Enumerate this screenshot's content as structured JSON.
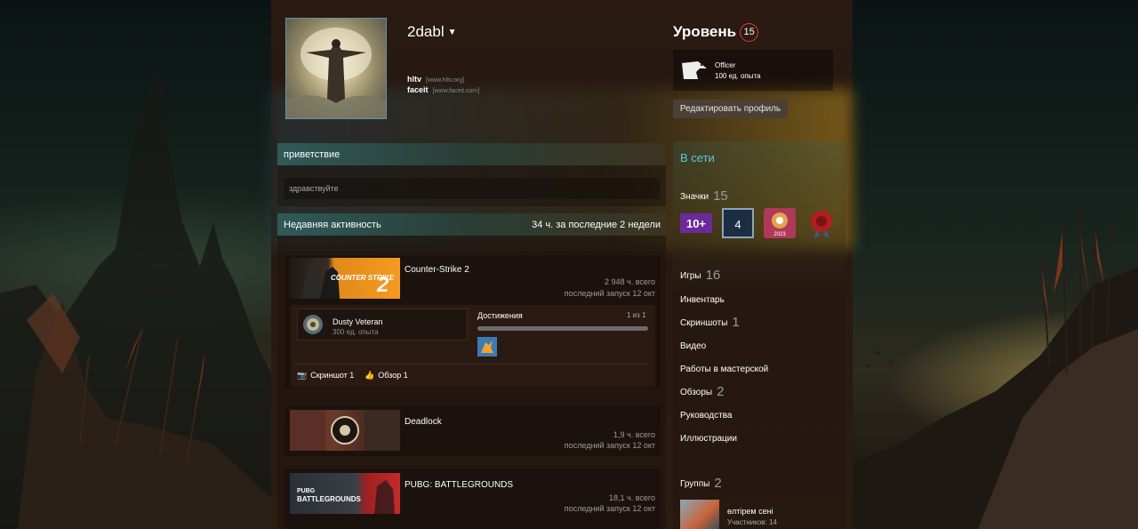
{
  "profile": {
    "name": "2dabl",
    "links": [
      {
        "label": "hltv",
        "url": "[www.hltv.org]"
      },
      {
        "label": "faceit",
        "url": "[www.faceit.com]"
      }
    ]
  },
  "level": {
    "label": "Уровень",
    "value": "15",
    "badge_title": "Officer",
    "badge_xp": "100 ед. опыта",
    "edit_button": "Редактировать профиль"
  },
  "greeting": {
    "title": "приветствие",
    "text": "здравствуйте"
  },
  "activity": {
    "title": "Недавняя активность",
    "summary": "34 ч. за последние 2 недели",
    "games": [
      {
        "name": "Counter-Strike 2",
        "hours": "2 948 ч. всего",
        "last": "последний запуск 12 окт"
      },
      {
        "name": "Deadlock",
        "hours": "1,9 ч. всего",
        "last": "последний запуск 12 окт"
      },
      {
        "name": "PUBG: BATTLEGROUNDS",
        "hours": "18,1 ч. всего",
        "last": "последний запуск 12 окт"
      }
    ],
    "achievement": {
      "badge_name": "Dusty Veteran",
      "badge_xp": "300 ед. опыта",
      "title": "Достижения",
      "count": "1 из 1",
      "progress": 1.0
    },
    "footer": {
      "screenshot": "Скриншот 1",
      "review": "Обзор 1"
    }
  },
  "sidebar": {
    "status": "В сети",
    "badges": {
      "label": "Значки",
      "count": "15",
      "icons": [
        "years-10-icon",
        "level-4-icon",
        "steam-2023-icon",
        "seal-award-icon"
      ],
      "years_text": "10+",
      "level_text": "4",
      "steam_year": "2023"
    },
    "items": [
      {
        "label": "Игры",
        "count": "16"
      },
      {
        "label": "Инвентарь",
        "count": ""
      },
      {
        "label": "Скриншоты",
        "count": "1"
      },
      {
        "label": "Видео",
        "count": ""
      },
      {
        "label": "Работы в мастерской",
        "count": ""
      },
      {
        "label": "Обзоры",
        "count": "2"
      },
      {
        "label": "Руководства",
        "count": ""
      },
      {
        "label": "Иллюстрации",
        "count": ""
      }
    ],
    "groups": {
      "label": "Группы",
      "count": "2",
      "first_name": "өлтірем сені",
      "first_members": "Участников: 14"
    }
  },
  "game_art": {
    "cs2_title": "COUNTER STRIKE",
    "cs2_number": "2",
    "pubg_small": "PUBG",
    "pubg_big": "BATTLEGROUNDS"
  },
  "colors": {
    "accent_online": "#57cbde",
    "level_ring": "#e4373c",
    "panel": "#261812"
  }
}
